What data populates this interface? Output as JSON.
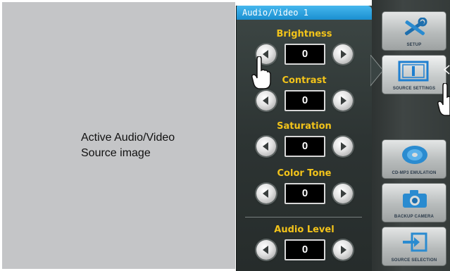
{
  "preview": {
    "line1": "Active Audio/Video",
    "line2": "Source image"
  },
  "panel": {
    "title": "Audio/Video 1",
    "controls": [
      {
        "label": "Brightness",
        "value": "0"
      },
      {
        "label": "Contrast",
        "value": "0"
      },
      {
        "label": "Saturation",
        "value": "0"
      },
      {
        "label": "Color Tone",
        "value": "0"
      },
      {
        "label": "Audio Level",
        "value": "0"
      }
    ]
  },
  "sidebar": {
    "buttons": [
      {
        "label": "SETUP",
        "icon": "tools-icon"
      },
      {
        "label": "SOURCE SETTINGS",
        "icon": "screen-icon"
      },
      {
        "label": "CD-MP3 EMULATION",
        "icon": "disc-icon"
      },
      {
        "label": "BACKUP CAMERA",
        "icon": "camera-icon"
      },
      {
        "label": "SOURCE SELECTION",
        "icon": "source-arrow-icon"
      }
    ]
  },
  "colors": {
    "header_blue": "#2aa3e0",
    "label_yellow": "#f2c31a",
    "panel_dark": "#2d3433"
  }
}
